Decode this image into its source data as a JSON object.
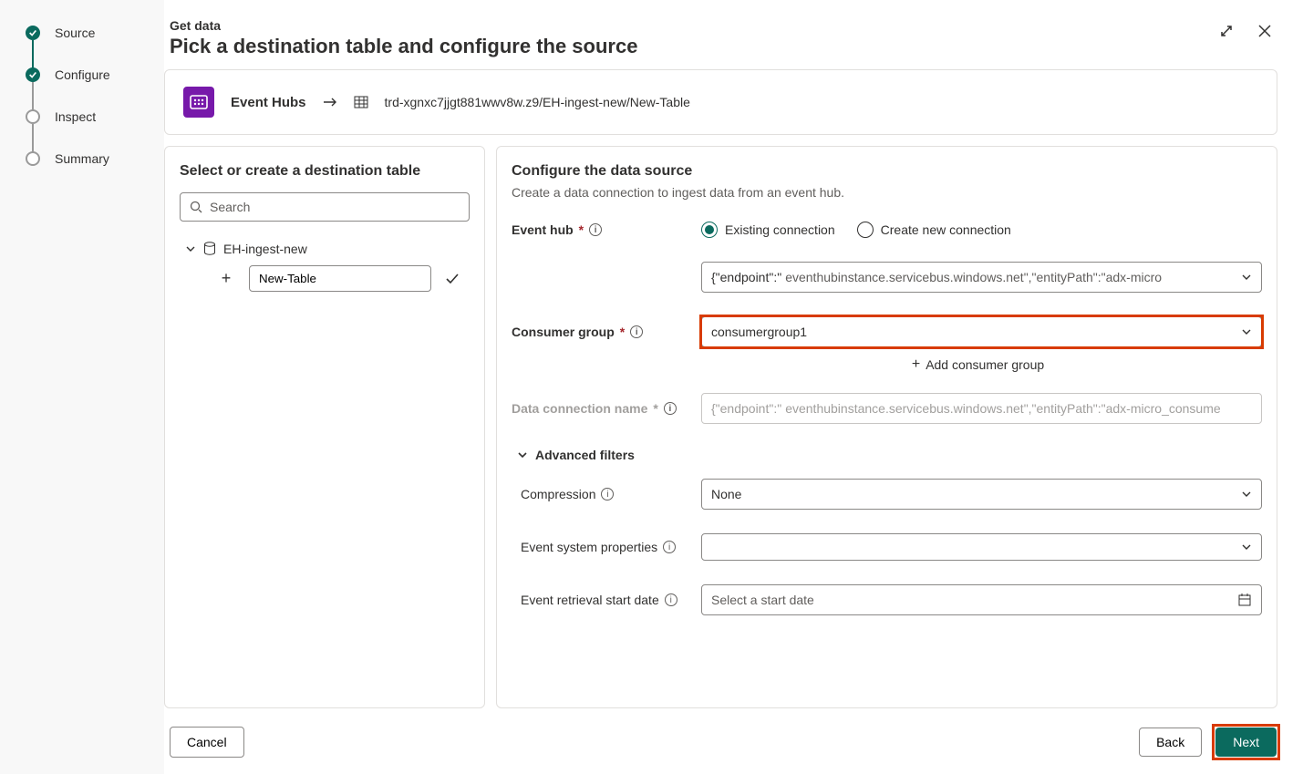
{
  "sidebar": {
    "steps": [
      "Source",
      "Configure",
      "Inspect",
      "Summary"
    ]
  },
  "header": {
    "eyebrow": "Get data",
    "title": "Pick a destination table and configure the source"
  },
  "breadcrumb": {
    "source_label": "Event Hubs",
    "path": "trd-xgnxc7jjgt881wwv8w.z9/EH-ingest-new/New-Table"
  },
  "leftPanel": {
    "title": "Select or create a destination table",
    "search_placeholder": "Search",
    "db_name": "EH-ingest-new",
    "new_table_value": "New-Table"
  },
  "rightPanel": {
    "title": "Configure the data source",
    "subtitle": "Create a data connection to ingest data from an event hub.",
    "labels": {
      "event_hub": "Event hub",
      "consumer_group": "Consumer group",
      "data_connection_name": "Data connection name",
      "advanced_filters": "Advanced filters",
      "compression": "Compression",
      "event_system_properties": "Event system properties",
      "event_retrieval_start_date": "Event retrieval start date"
    },
    "radio": {
      "existing": "Existing connection",
      "create_new": "Create new connection"
    },
    "eventhub_prefix": "{\"endpoint\":\"",
    "eventhub_suffix": "eventhubinstance.servicebus.windows.net\",\"entityPath\":\"adx-micro",
    "consumer_group_value": "consumergroup1",
    "add_consumer_group": "Add consumer group",
    "dataconn_prefix": "{\"endpoint\":\"",
    "dataconn_suffix": "eventhubinstance.servicebus.windows.net\",\"entityPath\":\"adx-micro_consume",
    "compression_value": "None",
    "start_date_placeholder": "Select a start date"
  },
  "footer": {
    "cancel": "Cancel",
    "back": "Back",
    "next": "Next"
  }
}
